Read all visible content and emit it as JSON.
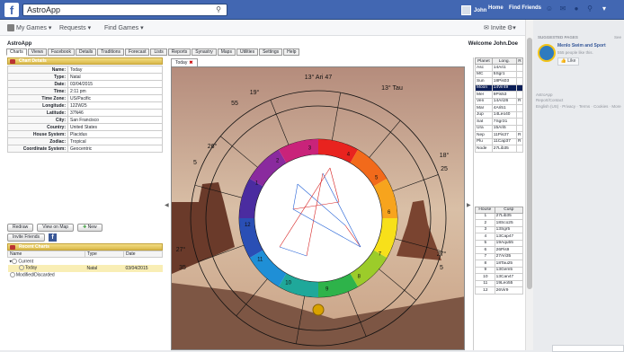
{
  "fb": {
    "search_value": "AstroApp",
    "user_name": "John",
    "nav": [
      "Home",
      "Find Friends"
    ]
  },
  "subnav": {
    "my_games": "My Games",
    "requests": "Requests",
    "find_games": "Find Games",
    "invite": "Invite"
  },
  "app": {
    "title": "AstroApp",
    "welcome": "Welcome John.Doe",
    "tabs": [
      "Charts",
      "Views",
      "Facebook",
      "Details",
      "Traditions",
      "Forecast",
      "Lists",
      "Reports",
      "Synastry",
      "Maps",
      "Utilities",
      "Settings",
      "Help"
    ]
  },
  "chart_details": {
    "header": "Chart Details",
    "rows": [
      {
        "label": "Name:",
        "value": "Today"
      },
      {
        "label": "Type:",
        "value": "Natal"
      },
      {
        "label": "Date:",
        "value": "03/04/2015"
      },
      {
        "label": "Time:",
        "value": "2:11 pm"
      },
      {
        "label": "Time Zone:",
        "value": "US/Pacific"
      },
      {
        "label": "Longitude:",
        "value": "122W25"
      },
      {
        "label": "Latitude:",
        "value": "37N46"
      },
      {
        "label": "City:",
        "value": "San Francisco"
      },
      {
        "label": "Country:",
        "value": "United States"
      },
      {
        "label": "House System:",
        "value": "Placidus"
      },
      {
        "label": "Zodiac:",
        "value": "Tropical"
      },
      {
        "label": "Coordinate System:",
        "value": "Geocentric"
      }
    ],
    "redraw": "Redraw",
    "view_on_map": "View on Map",
    "new": "New",
    "invite_friends": "Invite Friends"
  },
  "recent": {
    "header": "Recent Charts",
    "cols": [
      "Name",
      "Type",
      "Date"
    ],
    "current": "Current",
    "today_name": "Today",
    "today_type": "Natal",
    "today_date": "03/04/2015",
    "modified": "Modified/Discarded"
  },
  "chart": {
    "tab": "Today",
    "house_cusps": [
      {
        "label": "13° Ari 47"
      },
      {
        "label": "13° Tau"
      },
      {
        "label": "19°"
      },
      {
        "label": "55"
      },
      {
        "label": "26°"
      },
      {
        "label": "5"
      },
      {
        "label": "27°"
      },
      {
        "label": "35"
      },
      {
        "label": "18°"
      },
      {
        "label": "25"
      },
      {
        "label": "27°"
      },
      {
        "label": "5"
      }
    ],
    "houses": [
      "1",
      "2",
      "3",
      "4",
      "5",
      "6",
      "7",
      "8",
      "9",
      "10",
      "11",
      "12"
    ]
  },
  "planets_table": {
    "cols": [
      "Planet",
      "Long.",
      "R"
    ],
    "rows": [
      {
        "p": "Asc",
        "l": "14Ari1",
        "r": ""
      },
      {
        "p": "MC",
        "l": "5Sgr1",
        "r": ""
      },
      {
        "p": "Sun",
        "l": "18Pis03",
        "r": ""
      },
      {
        "p": "Moon",
        "l": "14Vir49",
        "r": ""
      },
      {
        "p": "Mer",
        "l": "9Pis53",
        "r": ""
      },
      {
        "p": "Ven",
        "l": "14Ari26",
        "r": "R"
      },
      {
        "p": "Mar",
        "l": "4Ari51",
        "r": ""
      },
      {
        "p": "Jup",
        "l": "14Leo40",
        "r": ""
      },
      {
        "p": "Sat",
        "l": "7Sgr31",
        "r": ""
      },
      {
        "p": "Ura",
        "l": "15Ari5",
        "r": ""
      },
      {
        "p": "Nep",
        "l": "11Pis37",
        "r": "R"
      },
      {
        "p": "Plu",
        "l": "11Cap37",
        "r": "R"
      },
      {
        "p": "Node",
        "l": "27Lib35",
        "r": ""
      }
    ]
  },
  "houses_table": {
    "cols": [
      "House",
      "Cusp"
    ],
    "rows": [
      {
        "h": "1",
        "c": "27Lib35"
      },
      {
        "h": "2",
        "c": "18Sco25"
      },
      {
        "h": "3",
        "c": "13Sgr5"
      },
      {
        "h": "4",
        "c": "13Cap47"
      },
      {
        "h": "5",
        "c": "19Aqu55"
      },
      {
        "h": "6",
        "c": "26Pis9"
      },
      {
        "h": "7",
        "c": "27Ari35"
      },
      {
        "h": "8",
        "c": "18Tau25"
      },
      {
        "h": "9",
        "c": "13Gem5"
      },
      {
        "h": "10",
        "c": "13Can47"
      },
      {
        "h": "11",
        "c": "19Leo55"
      },
      {
        "h": "12",
        "c": "26Vir9"
      }
    ]
  },
  "right": {
    "suggested": "SUGGESTED PAGES",
    "see": "See",
    "page_name": "Menlo Swim and Sport",
    "page_likes": "555 people like this.",
    "like": "Like",
    "app_name": "AstroApp",
    "report": "Report/Contact",
    "footer": "English (US) · Privacy · Terms · Cookies · More"
  }
}
